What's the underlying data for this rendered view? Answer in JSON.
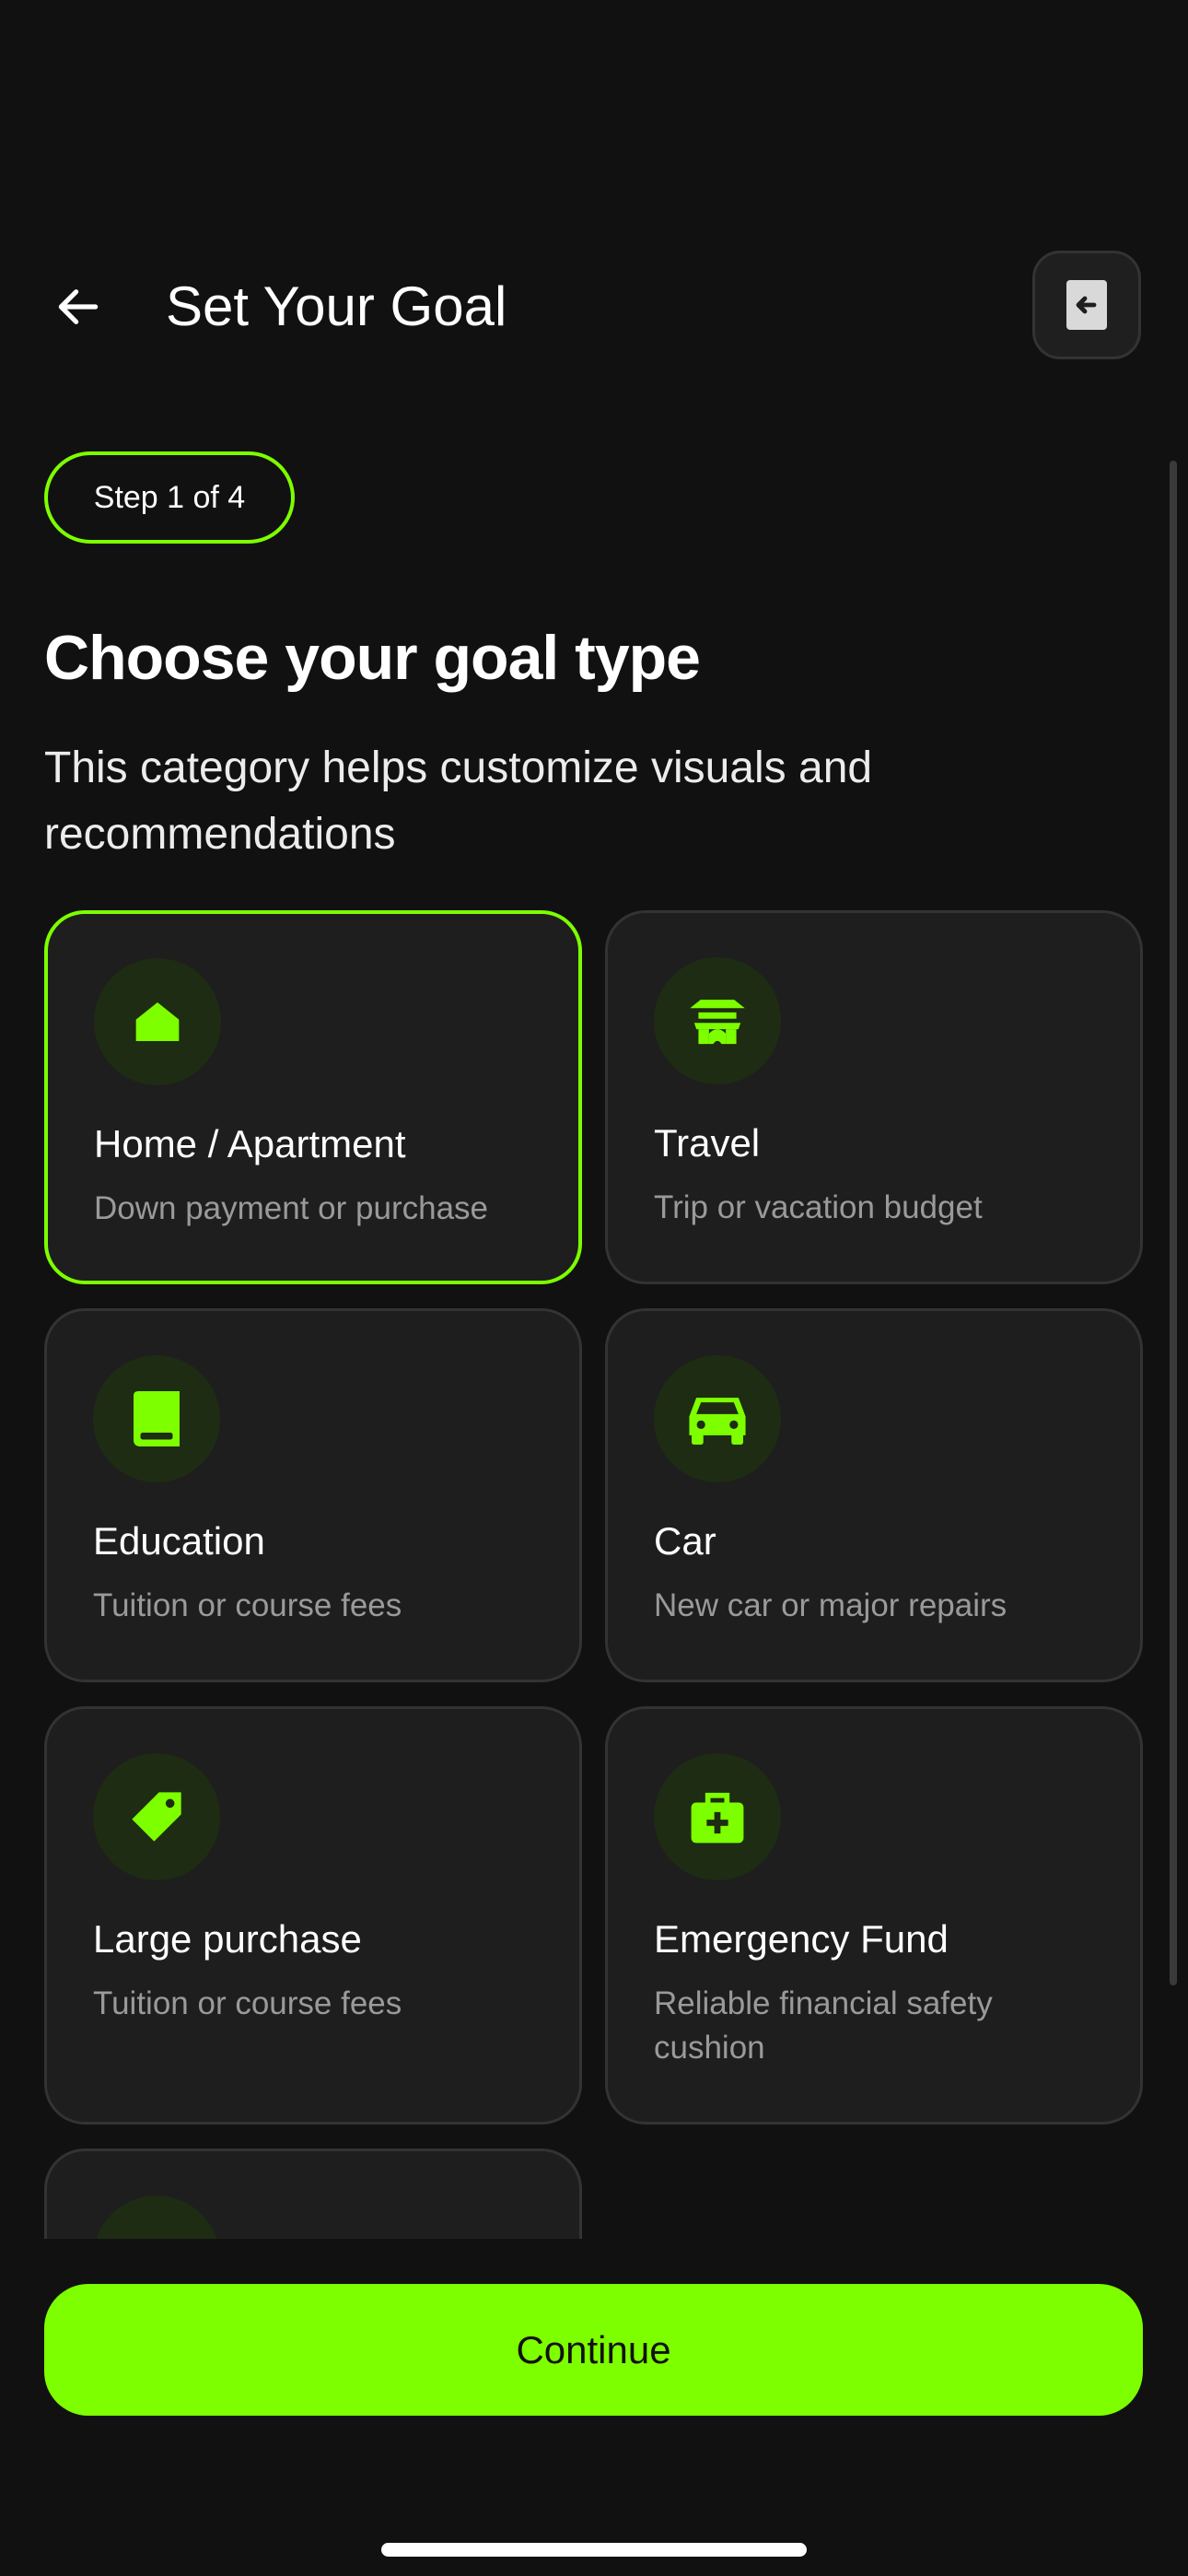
{
  "header": {
    "title": "Set Your Goal",
    "back_icon": "arrow-left-icon",
    "exit_icon": "exit-door-icon"
  },
  "step": {
    "label": "Step 1 of 4"
  },
  "main": {
    "heading": "Choose your goal type",
    "subheading": "This category helps customize visuals and recommendations"
  },
  "goal_types": [
    {
      "title": "Home / Apartment",
      "description": "Down payment or purchase",
      "icon": "house-icon",
      "selected": true
    },
    {
      "title": "Travel",
      "description": "Trip or vacation budget",
      "icon": "pagoda-icon",
      "selected": false
    },
    {
      "title": "Education",
      "description": "Tuition or course fees",
      "icon": "book-icon",
      "selected": false
    },
    {
      "title": "Car",
      "description": "New car or major repairs",
      "icon": "car-icon",
      "selected": false
    },
    {
      "title": "Large purchase",
      "description": "Tuition or course fees",
      "icon": "price-tag-icon",
      "selected": false
    },
    {
      "title": "Emergency Fund",
      "description": "Reliable financial safety cushion",
      "icon": "first-aid-kit-icon",
      "selected": false
    },
    {
      "title": "",
      "description": "",
      "icon": "heart-icon",
      "selected": false
    }
  ],
  "footer": {
    "continue_label": "Continue"
  },
  "colors": {
    "background": "#111111",
    "card": "#1e1e1e",
    "card_border": "#333333",
    "accent": "#7dff00",
    "icon_bg": "#1e2c13",
    "muted_text": "#9a9a9a"
  }
}
